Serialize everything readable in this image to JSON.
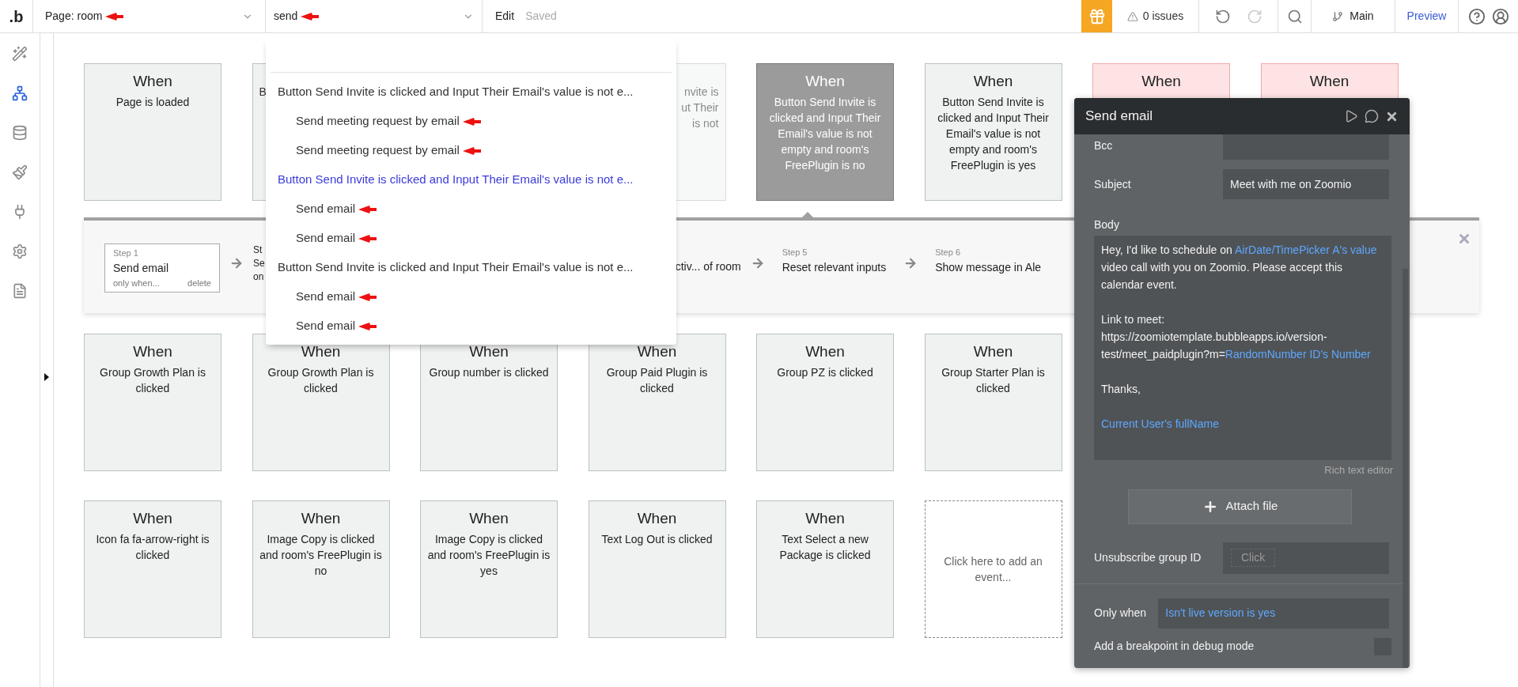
{
  "topbar": {
    "logo": ".b",
    "page_selector": "Page: room",
    "workflow_selector": "send",
    "edit": "Edit",
    "saved": "Saved",
    "issues": "0 issues",
    "branch": "Main",
    "preview": "Preview"
  },
  "sidebar": [
    {
      "kind": "design",
      "selected": false
    },
    {
      "kind": "workflow",
      "selected": true
    },
    {
      "kind": "data",
      "selected": false
    },
    {
      "kind": "styles",
      "selected": false
    },
    {
      "kind": "plugins",
      "selected": false
    },
    {
      "kind": "settings",
      "selected": false
    },
    {
      "kind": "logs",
      "selected": false
    }
  ],
  "rows": [
    [
      {
        "kind": "event",
        "title": "When",
        "text": "Page is loaded"
      },
      {
        "kind": "partial_left",
        "faded": false,
        "lines": [
          "B"
        ]
      },
      {
        "kind": "covered"
      },
      {
        "kind": "partial_right",
        "faded": true,
        "lines": [
          "nvite is",
          "ut Their",
          "is not"
        ]
      },
      {
        "kind": "selected",
        "title": "When",
        "text": "Button Send Invite is clicked and Input Their Email's value is not empty and room's FreePlugin is no"
      },
      {
        "kind": "event",
        "title": "When",
        "text": "Button Send Invite is clicked and Input Their Email's value is not empty and room's FreePlugin is yes"
      },
      {
        "kind": "error",
        "title": "When"
      },
      {
        "kind": "error",
        "title": "When"
      }
    ],
    [
      {
        "kind": "event",
        "title": "When",
        "text": "Group Growth Plan is clicked"
      },
      {
        "kind": "event",
        "title": "When",
        "text": "Group Growth Plan is clicked"
      },
      {
        "kind": "event",
        "title": "When",
        "text": "Group number is clicked"
      },
      {
        "kind": "event",
        "title": "When",
        "text": "Group Paid Plugin is clicked"
      },
      {
        "kind": "event",
        "title": "When",
        "text": "Group PZ is clicked"
      },
      {
        "kind": "event",
        "title": "When",
        "text": "Group Starter Plan is clicked"
      }
    ],
    [
      {
        "kind": "event",
        "title": "When",
        "text": "Icon fa fa-arrow-right is clicked"
      },
      {
        "kind": "event",
        "title": "When",
        "text": "Image Copy is clicked and room's FreePlugin is no"
      },
      {
        "kind": "event",
        "title": "When",
        "text": "Image Copy is clicked and room's FreePlugin is yes"
      },
      {
        "kind": "event",
        "title": "When",
        "text": "Text Log Out is clicked"
      },
      {
        "kind": "event",
        "title": "When",
        "text": "Text Select a new Package is clicked"
      },
      {
        "kind": "add",
        "text": "Click here to add an event..."
      }
    ]
  ],
  "steps": [
    {
      "kind": "step",
      "selected": true,
      "label": "Step 1",
      "name": "Send email",
      "condition": "only when...",
      "action": "delete"
    },
    {
      "kind": "partial_left",
      "lines": [
        "St",
        "Se",
        "on"
      ]
    },
    {
      "kind": "partial_right",
      "lines": [
        "ctiv... of room"
      ]
    },
    {
      "kind": "step",
      "selected": false,
      "label": "Step 5",
      "name": "Reset relevant inputs"
    },
    {
      "kind": "step",
      "selected": false,
      "label": "Step 6",
      "name": "Show message in Ale"
    }
  ],
  "dropdown": {
    "groups": [
      {
        "title": "Button Send Invite is clicked and Input Their Email's value is not e...",
        "selected": false,
        "children": [
          "Send meeting request by email",
          "Send meeting request by email"
        ]
      },
      {
        "title": "Button Send Invite is clicked and Input Their Email's value is not e...",
        "selected": true,
        "children": [
          "Send email",
          "Send email"
        ]
      },
      {
        "title": "Button Send Invite is clicked and Input Their Email's value is not e...",
        "selected": false,
        "children": [
          "Send email",
          "Send email"
        ]
      }
    ]
  },
  "panel": {
    "title": "Send email",
    "fields": [
      {
        "label": "Bcc"
      },
      {
        "label": "Subject",
        "value": "Meet with me on Zoomio"
      }
    ],
    "body_label": "Body",
    "body": [
      [
        {
          "kind": "text",
          "text": "Hey, I'd like to schedule on "
        },
        {
          "kind": "dynamic",
          "text": "AirDate/TimePicker A's value"
        },
        {
          "kind": "text",
          "text": " video call with you on Zoomio. Please accept this calendar event."
        }
      ],
      [
        {
          "kind": "text",
          "text": "Link to meet: https://zoomiotemplate.bubbleapps.io/version-test/meet_paidplugin?m="
        },
        {
          "kind": "dynamic",
          "text": "RandomNumber ID's Number"
        }
      ],
      [
        {
          "kind": "text",
          "text": "Thanks,"
        }
      ],
      [
        {
          "kind": "dynamic",
          "text": "Current User's fullName"
        }
      ]
    ],
    "rich_text_label": "Rich text editor",
    "attach": "Attach file",
    "unsubscribe_label": "Unsubscribe group ID",
    "unsubscribe_button": "Click",
    "only_when_label": "Only when",
    "only_when": "Isn't live version is yes",
    "breakpoint_label": "Add a breakpoint in debug mode",
    "breakpoint_checked": false
  }
}
